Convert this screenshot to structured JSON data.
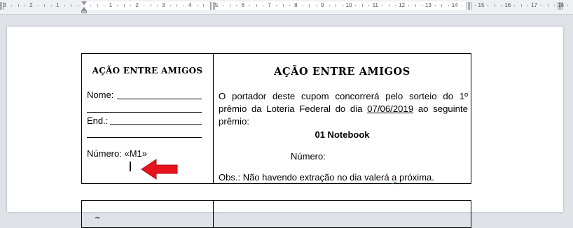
{
  "ruler": {
    "numbers": [
      "3",
      "2",
      "1",
      "1",
      "2",
      "3",
      "4",
      "5",
      "6",
      "7",
      "8",
      "9",
      "10",
      "11",
      "12",
      "13",
      "14",
      "15",
      "16",
      "17",
      "18"
    ]
  },
  "coupon": {
    "left_title": "AÇÃO ENTRE AMIGOS",
    "nome_label": "Nome:",
    "end_label": "End.:",
    "numero_left": "Número: «M1»",
    "right_title": "AÇÃO ENTRE AMIGOS",
    "body_part1": "O portador deste cupom concorrerá pelo sorteio do 1º prêmio da Loteria Federal do dia ",
    "body_date": "07/06/2019",
    "body_part2": " ao seguinte prêmio:",
    "prize": "01 Notebook",
    "numero_right": "Número:",
    "obs_label": "Obs.:",
    "obs_text_before": " Não havendo extração no dia valerá ",
    "obs_wavy": "a",
    "obs_text_after": " próxima."
  },
  "second_coupon": {
    "fragment": "~"
  },
  "colors": {
    "arrow": "#e8141b",
    "spellcheck": "#2b7d2b",
    "page_background": "#dfe3e8"
  }
}
